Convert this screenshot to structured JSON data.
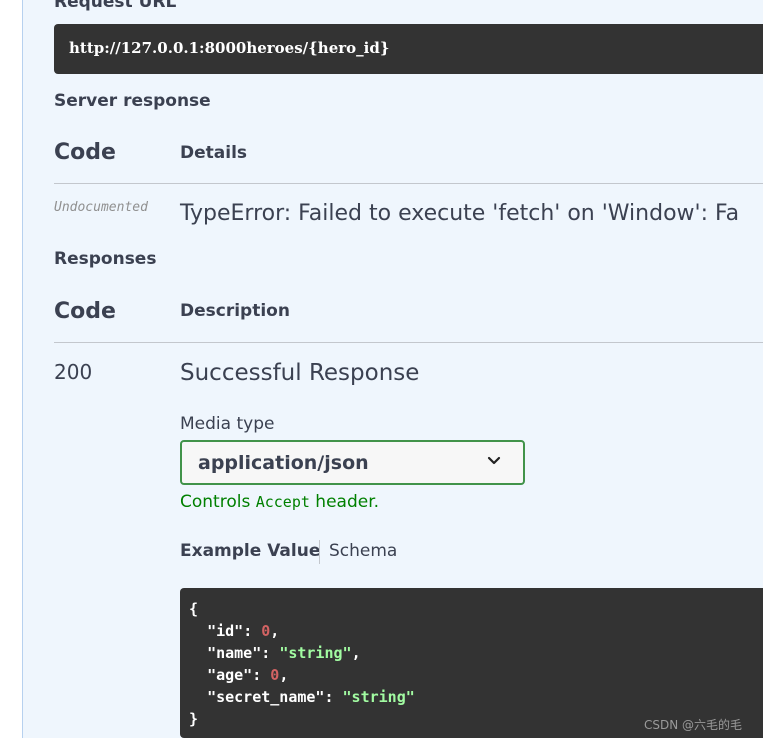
{
  "request_url": {
    "label": "Request URL",
    "value": "http://127.0.0.1:8000heroes/{hero_id}"
  },
  "server_response": {
    "label": "Server response",
    "code_header": "Code",
    "details_header": "Details",
    "rows": [
      {
        "code": "Undocumented",
        "details": "TypeError: Failed to execute 'fetch' on 'Window': Fa"
      }
    ]
  },
  "responses": {
    "label": "Responses",
    "code_header": "Code",
    "description_header": "Description",
    "rows": [
      {
        "code": "200",
        "description": "Successful Response",
        "media_type_label": "Media type",
        "media_type_value": "application/json",
        "controls_prefix": "Controls ",
        "controls_code": "Accept",
        "controls_suffix": " header.",
        "tabs": [
          "Example Value",
          "Schema"
        ],
        "example": {
          "open": "{",
          "close": "}",
          "fields": [
            {
              "key": "\"id\"",
              "value": "0",
              "kind": "number",
              "comma": ","
            },
            {
              "key": "\"name\"",
              "value": "\"string\"",
              "kind": "string",
              "comma": ","
            },
            {
              "key": "\"age\"",
              "value": "0",
              "kind": "number",
              "comma": ","
            },
            {
              "key": "\"secret_name\"",
              "value": "\"string\"",
              "kind": "string",
              "comma": ""
            }
          ]
        }
      }
    ]
  },
  "watermark": "CSDN @六毛的毛",
  "colors": {
    "panel_bg": "#eff6fd",
    "code_bg": "#333333",
    "accent_green": "#41934a",
    "json_number": "#d36363",
    "json_string": "#a2fca2"
  }
}
